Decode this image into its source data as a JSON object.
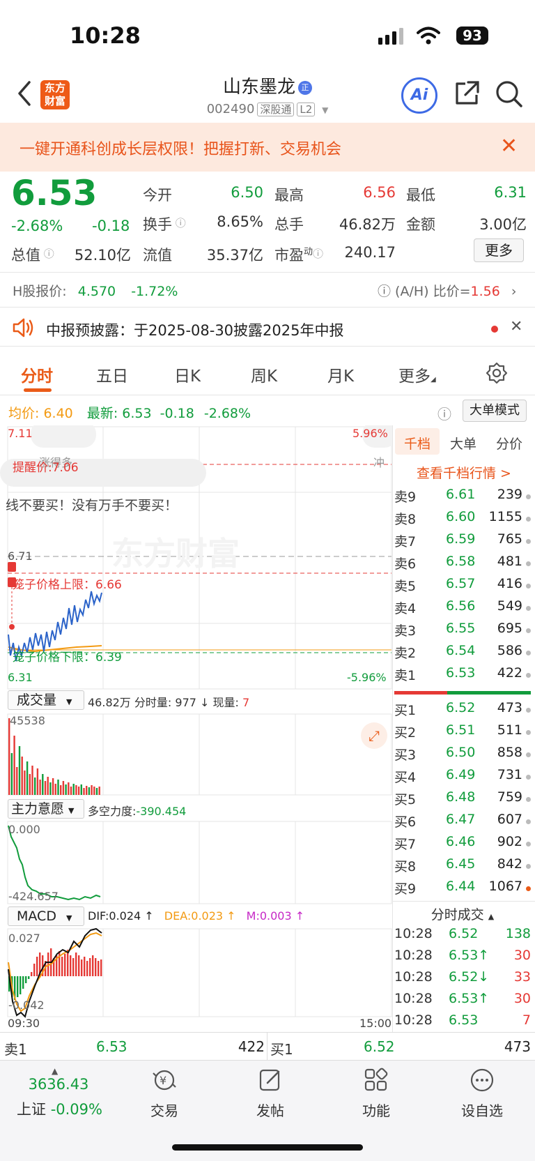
{
  "status": {
    "time": "10:28",
    "battery": "93"
  },
  "header": {
    "logo_line1": "东方",
    "logo_line2": "财富",
    "name": "山东墨龙",
    "badge": "正",
    "code": "002490",
    "tag_exchange": "深股通",
    "tag_level": "L2",
    "ai_label": "Ai"
  },
  "banner": {
    "text": "一键开通科创成长层权限！把握打新、交易机会"
  },
  "quote": {
    "price": "6.53",
    "change_pct": "-2.68%",
    "change": "-0.18",
    "open_label": "今开",
    "open": "6.50",
    "high_label": "最高",
    "high": "6.56",
    "low_label": "最低",
    "low": "6.31",
    "turnover_label": "换手",
    "turnover": "8.65%",
    "volume_label": "总手",
    "volume": "46.82万",
    "amount_label": "金额",
    "amount": "3.00亿",
    "mktcap_label": "总值",
    "mktcap": "52.10亿",
    "float_label": "流值",
    "float_cap": "35.37亿",
    "pe_label": "市盈",
    "pe_sup": "动",
    "pe": "240.17",
    "more": "更多"
  },
  "h_share": {
    "label": "H股报价:",
    "price": "4.570",
    "change": "-1.72%",
    "ratio_label": "(A/H) 比价=",
    "ratio": "1.56"
  },
  "notice": {
    "text": "中报预披露：于2025-08-30披露2025年中报"
  },
  "tabs": [
    "分时",
    "五日",
    "日K",
    "周K",
    "月K",
    "更多"
  ],
  "info": {
    "avg_label": "均价:",
    "avg": "6.40",
    "last_label": "最新:",
    "last": "6.53",
    "chg": "-0.18",
    "pct": "-2.68%",
    "big_order": "大单模式"
  },
  "chart": {
    "top_price": "7.11",
    "top_pct": "5.96%",
    "bottom_price": "6.31",
    "bottom_pct": "-5.96%",
    "alert_label": "提醒价:7.06",
    "bubble_left": "涨得多",
    "bubble_right": "冲",
    "comment": "线不要买！没有万手不要买！",
    "ref_price": "6.71",
    "cage_upper": "笼子价格上限：6.66",
    "cage_lower": "笼子价格下限：6.39",
    "vol_selector": "成交量",
    "vol_info_a": "46.82万",
    "vol_info_b": "分时量: 977 ↓",
    "vol_info_c_label": "现量:",
    "vol_info_c": "7",
    "vol_max": "45538",
    "mf_selector": "主力意愿",
    "mf_info_label": "多空力度:",
    "mf_info": "-390.454",
    "mf_top": "0.000",
    "mf_bottom": "-424.657",
    "macd_selector": "MACD",
    "dif": "DIF:0.024 ↑",
    "dea": "DEA:0.023 ↑",
    "m": "M:0.003 ↑",
    "macd_top": "0.027",
    "macd_bottom": "-0.042",
    "time_start": "09:30",
    "time_end": "15:00"
  },
  "orderbook": {
    "tabs": [
      "千档",
      "大单",
      "分价"
    ],
    "view_all": "查看千档行情 >",
    "asks": [
      {
        "label": "卖9",
        "price": "6.61",
        "qty": "239"
      },
      {
        "label": "卖8",
        "price": "6.60",
        "qty": "1155"
      },
      {
        "label": "卖7",
        "price": "6.59",
        "qty": "765"
      },
      {
        "label": "卖6",
        "price": "6.58",
        "qty": "481"
      },
      {
        "label": "卖5",
        "price": "6.57",
        "qty": "416"
      },
      {
        "label": "卖4",
        "price": "6.56",
        "qty": "549"
      },
      {
        "label": "卖3",
        "price": "6.55",
        "qty": "695"
      },
      {
        "label": "卖2",
        "price": "6.54",
        "qty": "586"
      },
      {
        "label": "卖1",
        "price": "6.53",
        "qty": "422"
      }
    ],
    "bids": [
      {
        "label": "买1",
        "price": "6.52",
        "qty": "473"
      },
      {
        "label": "买2",
        "price": "6.51",
        "qty": "511"
      },
      {
        "label": "买3",
        "price": "6.50",
        "qty": "858"
      },
      {
        "label": "买4",
        "price": "6.49",
        "qty": "731"
      },
      {
        "label": "买5",
        "price": "6.48",
        "qty": "759"
      },
      {
        "label": "买6",
        "price": "6.47",
        "qty": "607"
      },
      {
        "label": "买7",
        "price": "6.46",
        "qty": "902"
      },
      {
        "label": "买8",
        "price": "6.45",
        "qty": "842"
      },
      {
        "label": "买9",
        "price": "6.44",
        "qty": "1067"
      }
    ],
    "ticks_title": "分时成交",
    "ticks": [
      {
        "time": "10:28",
        "price": "6.52",
        "qty": "138"
      },
      {
        "time": "10:28",
        "price": "6.53↑",
        "qty": "30"
      },
      {
        "time": "10:28",
        "price": "6.52↓",
        "qty": "33"
      },
      {
        "time": "10:28",
        "price": "6.53↑",
        "qty": "30"
      },
      {
        "time": "10:28",
        "price": "6.53",
        "qty": "7"
      }
    ]
  },
  "bidask": {
    "ask_label": "卖1",
    "ask_price": "6.53",
    "ask_qty": "422",
    "bid_label": "买1",
    "bid_price": "6.52",
    "bid_qty": "473"
  },
  "nav": {
    "index_value": "3636.43",
    "index_name": "上证",
    "index_change": "-0.09%",
    "items": [
      "交易",
      "发帖",
      "功能",
      "设自选"
    ]
  },
  "colors": {
    "up": "#e53935",
    "down": "#119c3c",
    "accent": "#ea5b18",
    "avg_line": "#f39a12",
    "price_line": "#2b63c9"
  }
}
